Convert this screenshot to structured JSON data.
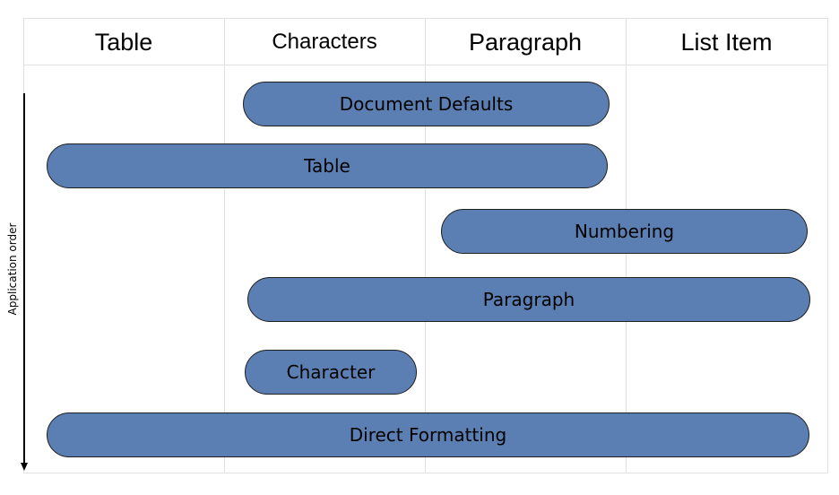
{
  "columns": [
    "Table",
    "Characters",
    "Paragraph",
    "List Item"
  ],
  "bars": [
    "Document Defaults",
    "Table",
    "Numbering",
    "Paragraph",
    "Character",
    "Direct Formatting"
  ],
  "axis": {
    "label": "Application order"
  },
  "colors": {
    "bar_fill": "#5b7fb2",
    "bar_border": "#1f1f1f",
    "grid": "#e1e1e1"
  }
}
